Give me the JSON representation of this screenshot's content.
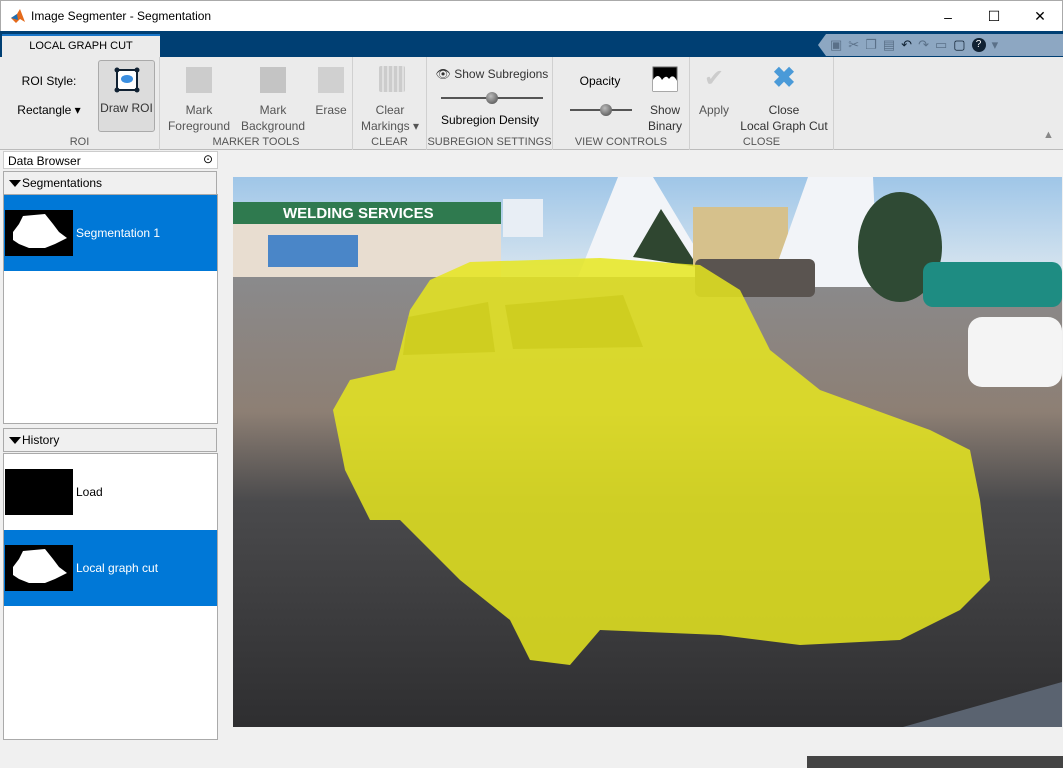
{
  "window": {
    "title": "Image Segmenter - Segmentation",
    "minimize": "–",
    "maximize": "☐",
    "close": "✕"
  },
  "tab": {
    "label": "LOCAL GRAPH CUT"
  },
  "quick_access": [
    "save-icon",
    "cut-icon",
    "copy-icon",
    "paste-icon",
    "undo-icon",
    "redo-icon",
    "print-icon",
    "window-icon",
    "help-icon",
    "menu-icon"
  ],
  "ribbon": {
    "roi": {
      "style_label": "ROI Style:",
      "style_value": "Rectangle",
      "draw_roi": "Draw ROI",
      "group": "ROI"
    },
    "marker": {
      "foreground": [
        "Mark",
        "Foreground"
      ],
      "background": [
        "Mark",
        "Background"
      ],
      "erase": "Erase",
      "group": "MARKER TOOLS"
    },
    "clear": {
      "label": [
        "Clear",
        "Markings"
      ],
      "group": "CLEAR"
    },
    "subregion": {
      "show": "Show Subregions",
      "density_label": "Subregion Density",
      "density_value": 0.5,
      "group": "SUBREGION SETTINGS"
    },
    "view": {
      "opacity_label": "Opacity",
      "opacity_value": 0.58,
      "show_binary": [
        "Show",
        "Binary"
      ],
      "group": "VIEW CONTROLS"
    },
    "close": {
      "apply": "Apply",
      "close": [
        "Close",
        "Local Graph Cut"
      ],
      "group": "CLOSE"
    }
  },
  "data_browser": {
    "title": "Data Browser",
    "segmentations": {
      "header": "Segmentations",
      "items": [
        {
          "label": "Segmentation 1",
          "selected": true
        }
      ]
    },
    "history": {
      "header": "History",
      "items": [
        {
          "label": "Load",
          "selected": false
        },
        {
          "label": "Local graph cut",
          "selected": true
        }
      ]
    }
  },
  "image": {
    "sign_text": "WELDING SERVICES",
    "overlay_color": "#e6e61e"
  },
  "colors": {
    "accent": "#0078d7",
    "tabstrip": "#003f73"
  }
}
